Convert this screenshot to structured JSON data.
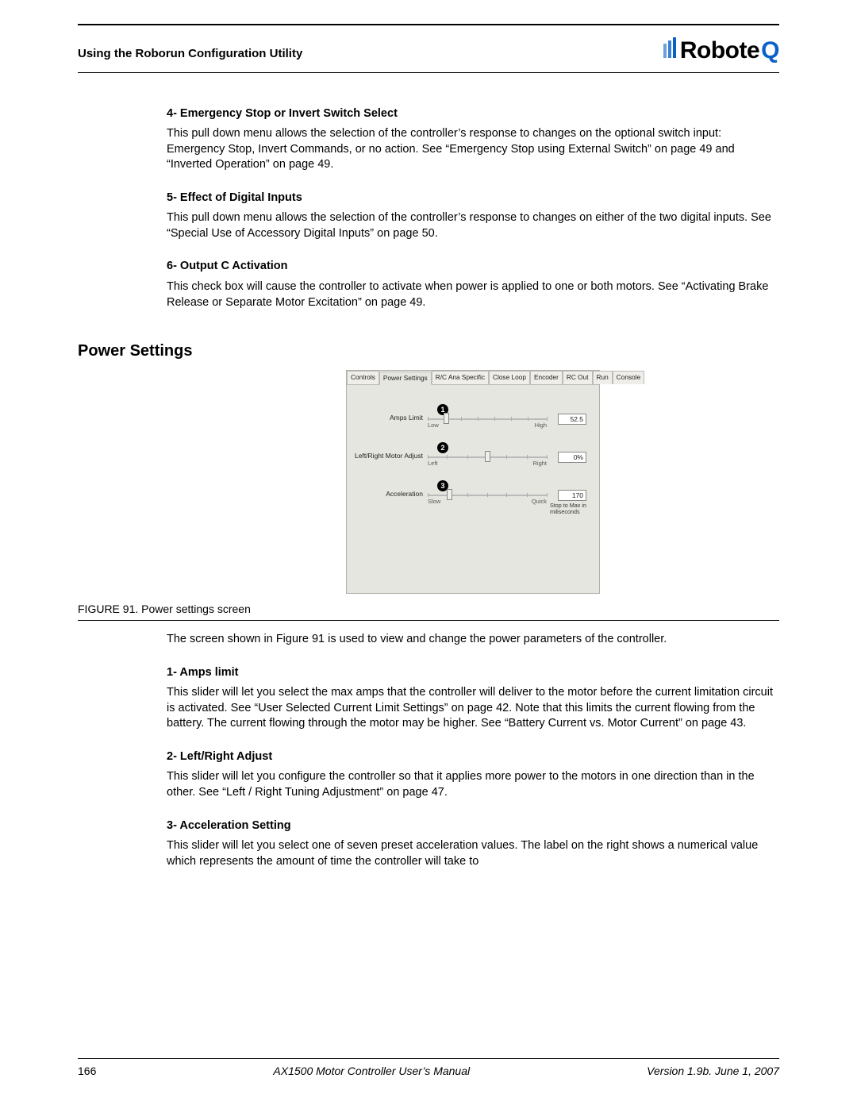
{
  "header": {
    "running_title": "Using the Roborun Configuration Utility",
    "brand_main": "Robote",
    "brand_accent": "Q"
  },
  "sections": {
    "s4_title": "4- Emergency Stop or Invert Switch Select",
    "s4_body": "This pull down menu allows the selection of the controller’s response to changes on the optional switch input: Emergency Stop, Invert Commands, or no action. See “Emergency Stop using External Switch” on page 49 and “Inverted Operation” on page 49.",
    "s5_title": "5- Effect of Digital Inputs",
    "s5_body": "This pull down menu allows the selection of the controller’s response to changes on either of the two digital inputs. See “Special Use of Accessory Digital Inputs” on page 50.",
    "s6_title": "6- Output C Activation",
    "s6_body": "This check box will cause the controller to activate when power is applied to one or both motors. See “Activating Brake Release or Separate Motor Excitation” on page 49.",
    "power_heading": "Power Settings",
    "fig_caption": "FIGURE 91.  Power settings screen",
    "fig_intro": "The screen shown in Figure 91 is used to view and change the power parameters of the controller.",
    "p1_title": "1- Amps limit",
    "p1_body": "This slider will let you select the max amps that the controller will deliver to the motor before the current limitation circuit is activated. See “User Selected Current Limit Settings” on page 42. Note that this limits the current flowing from the battery. The current flowing through the motor may be higher. See “Battery Current vs. Motor Current” on page 43.",
    "p2_title": "2- Left/Right Adjust",
    "p2_body": "This slider will let you configure the controller so that it applies more power to the motors in one direction than in the other. See “Left / Right Tuning Adjustment” on page 47.",
    "p3_title": "3- Acceleration Setting",
    "p3_body": "This slider will let you select one of seven preset acceleration values. The label on the right shows a numerical value which represents the amount of time the controller will take to"
  },
  "figure": {
    "tabs": [
      "Controls",
      "Power Settings",
      "R/C Ana Specific",
      "Close Loop",
      "Encoder",
      "RC Out",
      "Run",
      "Console"
    ],
    "active_tab_index": 1,
    "rows": [
      {
        "num": "1",
        "label": "Amps Limit",
        "left": "Low",
        "right": "High",
        "value": "52.5",
        "caption": ""
      },
      {
        "num": "2",
        "label": "Left/Right Motor Adjust",
        "left": "Left",
        "right": "Right",
        "value": "0%",
        "caption": ""
      },
      {
        "num": "3",
        "label": "Acceleration",
        "left": "Slow",
        "right": "Quick",
        "value": "170",
        "caption": "Stop to Max in miliseconds"
      }
    ]
  },
  "footer": {
    "page": "166",
    "manual": "AX1500 Motor Controller User’s Manual",
    "version": "Version 1.9b. June 1, 2007"
  }
}
